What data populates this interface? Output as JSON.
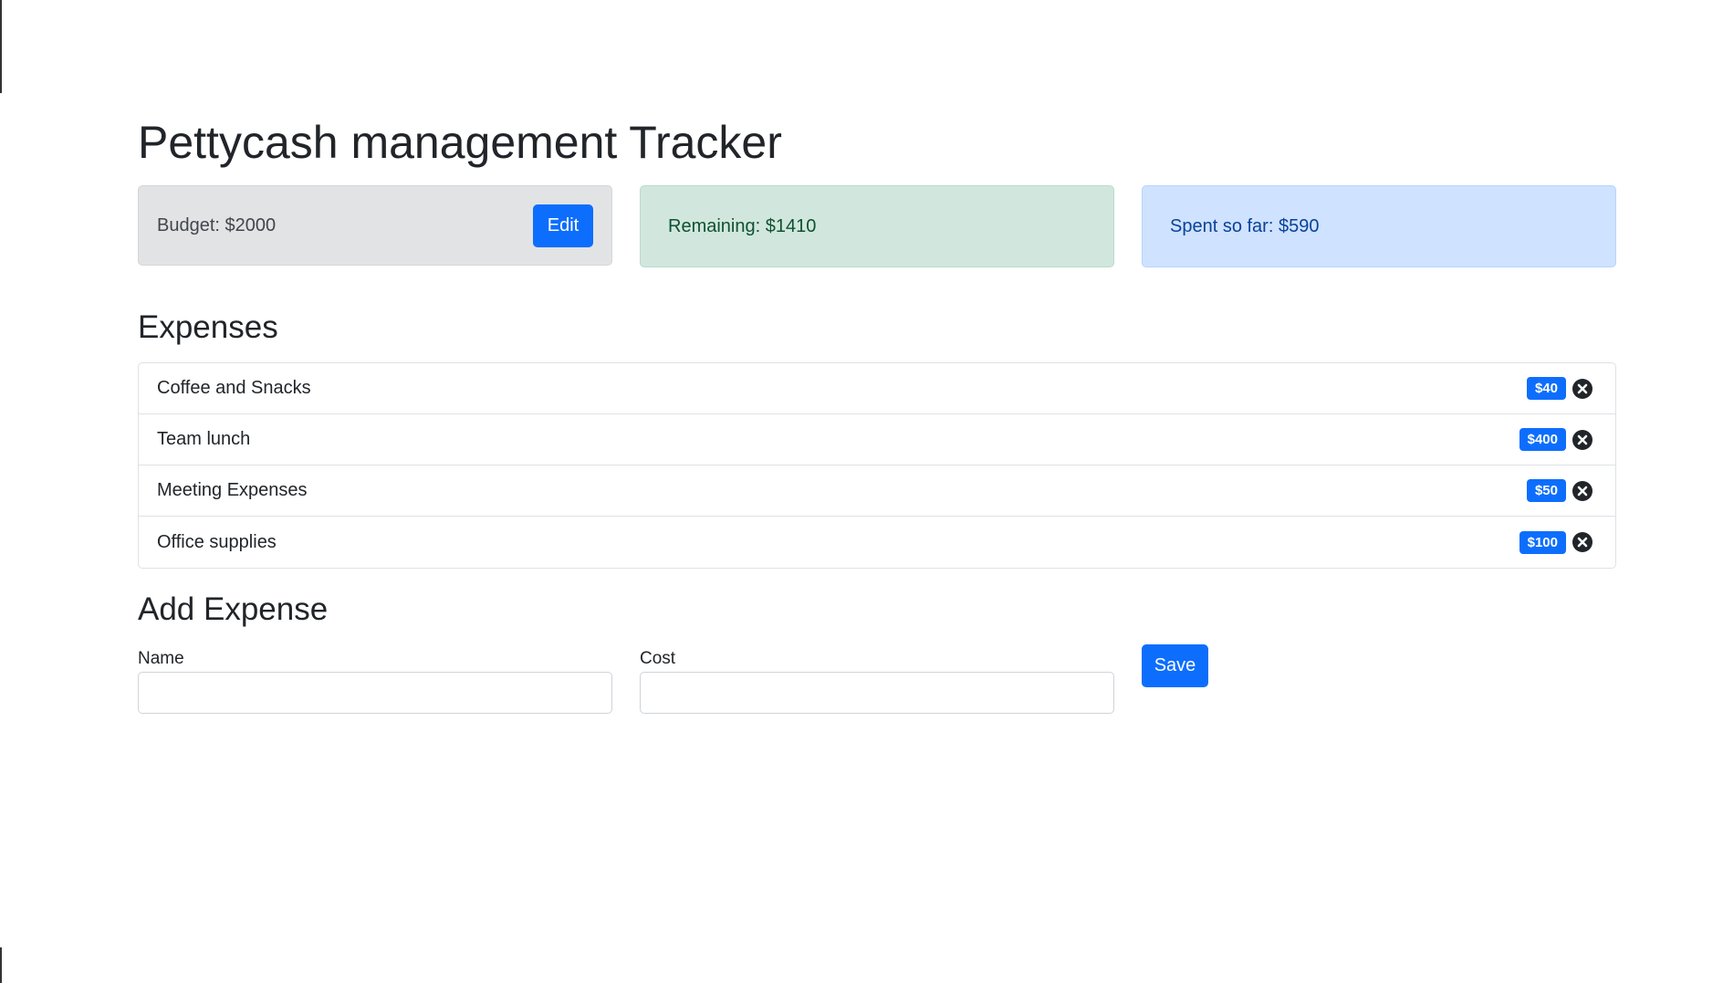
{
  "header": {
    "title": "Pettycash management Tracker"
  },
  "stats": {
    "budget_text": "Budget: $2000",
    "edit_label": "Edit",
    "remaining_text": "Remaining: $1410",
    "spent_text": "Spent so far: $590"
  },
  "expenses": {
    "heading": "Expenses",
    "items": [
      {
        "name": "Coffee and Snacks",
        "cost": "$40",
        "delete_icon": "close-circle-icon"
      },
      {
        "name": "Team lunch",
        "cost": "$400",
        "delete_icon": "close-circle-icon"
      },
      {
        "name": "Meeting Expenses",
        "cost": "$50",
        "delete_icon": "close-circle-icon"
      },
      {
        "name": "Office supplies",
        "cost": "$100",
        "delete_icon": "close-circle-icon"
      }
    ]
  },
  "add_expense": {
    "heading": "Add Expense",
    "name_label": "Name",
    "name_value": "",
    "cost_label": "Cost",
    "cost_value": "",
    "save_label": "Save"
  },
  "colors": {
    "primary": "#0d6efd",
    "budget_bg": "#e2e3e5",
    "remaining_bg": "#d1e7dd",
    "spent_bg": "#cfe2ff"
  }
}
